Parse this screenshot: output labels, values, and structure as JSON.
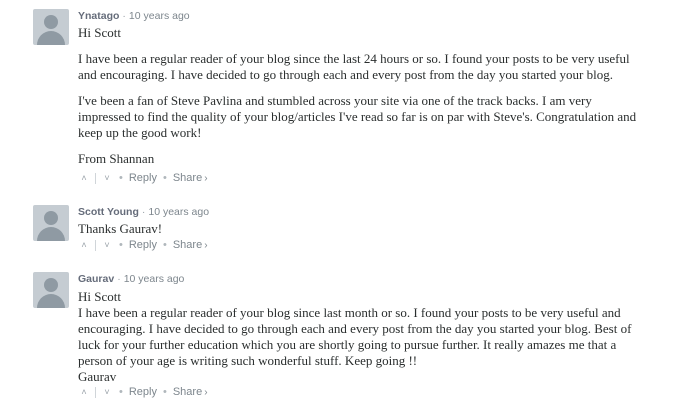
{
  "comments": [
    {
      "author": "Ynatago",
      "time": "10 years ago",
      "paragraphs": [
        "Hi Scott",
        "I have been a regular reader of your blog since the last 24 hours or so. I found your posts to be very useful and encouraging. I have decided to go through each and every post from the day you started your blog.",
        "I've been a fan of Steve Pavlina and stumbled across your site via one of the track backs. I am very impressed to find the quality of your blog/articles I've read so far is on par with Steve's. Congratulation and keep up the good work!",
        "From Shannan"
      ]
    },
    {
      "author": "Scott Young",
      "time": "10 years ago",
      "paragraphs": [
        "Thanks Gaurav!"
      ]
    },
    {
      "author": "Gaurav",
      "time": "10 years ago",
      "paragraphs": [
        "Hi Scott",
        "I have been a regular reader of your blog since last month or so. I found your posts to be very useful and encouraging. I have decided to go through each and every post from the day you started your blog. Best of luck for your further education which you are shortly going to pursue further. It really amazes me that a person of your age is writing such wonderful stuff. Keep going !!",
        "Gaurav"
      ]
    }
  ],
  "actions": {
    "upvote_icon": "chevron-up-icon",
    "downvote_icon": "chevron-down-icon",
    "reply_label": "Reply",
    "share_label": "Share",
    "share_icon": "chevron-right-icon"
  }
}
